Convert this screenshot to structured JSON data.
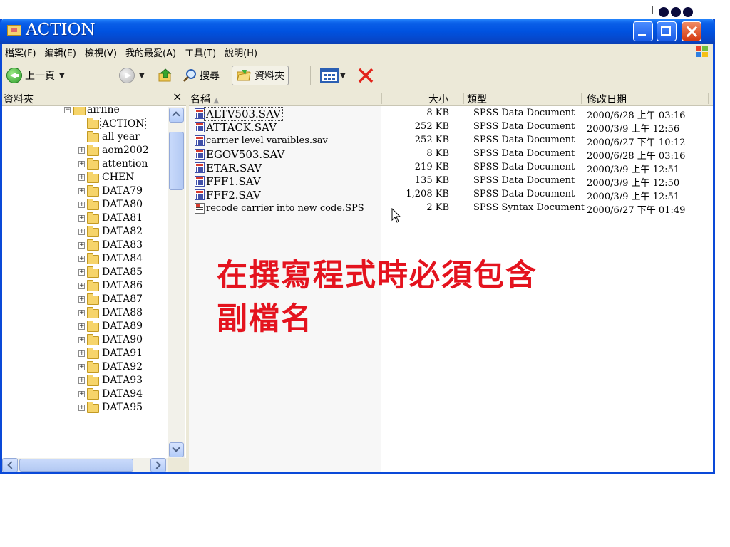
{
  "window": {
    "title": "ACTION"
  },
  "menubar": {
    "items": [
      "檔案(F)",
      "編輯(E)",
      "檢視(V)",
      "我的最愛(A)",
      "工具(T)",
      "說明(H)"
    ]
  },
  "toolbar": {
    "back_label": "上一頁",
    "search_label": "搜尋",
    "folders_label": "資料夾"
  },
  "folder_pane": {
    "title": "資料夾",
    "close_glyph": "×",
    "tree": [
      {
        "label": "airline",
        "level": 0,
        "expander": "−"
      },
      {
        "label": "ACTION",
        "level": 1,
        "selected": true
      },
      {
        "label": "all year",
        "level": 1
      },
      {
        "label": "aom2002",
        "level": 1,
        "expander": "+"
      },
      {
        "label": "attention",
        "level": 1,
        "expander": "+"
      },
      {
        "label": "CHEN",
        "level": 1,
        "expander": "+"
      },
      {
        "label": "DATA79",
        "level": 1,
        "expander": "+"
      },
      {
        "label": "DATA80",
        "level": 1,
        "expander": "+"
      },
      {
        "label": "DATA81",
        "level": 1,
        "expander": "+"
      },
      {
        "label": "DATA82",
        "level": 1,
        "expander": "+"
      },
      {
        "label": "DATA83",
        "level": 1,
        "expander": "+"
      },
      {
        "label": "DATA84",
        "level": 1,
        "expander": "+"
      },
      {
        "label": "DATA85",
        "level": 1,
        "expander": "+"
      },
      {
        "label": "DATA86",
        "level": 1,
        "expander": "+"
      },
      {
        "label": "DATA87",
        "level": 1,
        "expander": "+"
      },
      {
        "label": "DATA88",
        "level": 1,
        "expander": "+"
      },
      {
        "label": "DATA89",
        "level": 1,
        "expander": "+"
      },
      {
        "label": "DATA90",
        "level": 1,
        "expander": "+"
      },
      {
        "label": "DATA91",
        "level": 1,
        "expander": "+"
      },
      {
        "label": "DATA92",
        "level": 1,
        "expander": "+"
      },
      {
        "label": "DATA93",
        "level": 1,
        "expander": "+"
      },
      {
        "label": "DATA94",
        "level": 1,
        "expander": "+"
      },
      {
        "label": "DATA95",
        "level": 1,
        "expander": "+"
      }
    ]
  },
  "file_list": {
    "columns": {
      "name": "名稱",
      "size": "大小",
      "type": "類型",
      "modified": "修改日期"
    },
    "sort_indicator": "▲",
    "files": [
      {
        "name": "ALTV503.SAV",
        "size": "8 KB",
        "type": "SPSS Data Document",
        "modified": "2000/6/28 上午 03:16",
        "icon": "spss-data-icon",
        "selected": true
      },
      {
        "name": "ATTACK.SAV",
        "size": "252 KB",
        "type": "SPSS Data Document",
        "modified": "2000/3/9 上午 12:56",
        "icon": "spss-data-icon"
      },
      {
        "name": "carrier  level varaibles.sav",
        "size": "252 KB",
        "type": "SPSS Data Document",
        "modified": "2000/6/27 下午 10:12",
        "icon": "spss-data-icon"
      },
      {
        "name": "EGOV503.SAV",
        "size": "8 KB",
        "type": "SPSS Data Document",
        "modified": "2000/6/28 上午 03:16",
        "icon": "spss-data-icon"
      },
      {
        "name": "ETAR.SAV",
        "size": "219 KB",
        "type": "SPSS Data Document",
        "modified": "2000/3/9 上午 12:51",
        "icon": "spss-data-icon"
      },
      {
        "name": "FFF1.SAV",
        "size": "135 KB",
        "type": "SPSS Data Document",
        "modified": "2000/3/9 上午 12:50",
        "icon": "spss-data-icon"
      },
      {
        "name": "FFF2.SAV",
        "size": "1,208 KB",
        "type": "SPSS Data Document",
        "modified": "2000/3/9 上午 12:51",
        "icon": "spss-data-icon"
      },
      {
        "name": "recode carrier into new code.SPS",
        "size": "2 KB",
        "type": "SPSS Syntax Document",
        "modified": "2000/6/27 下午 01:49",
        "icon": "spss-syntax-icon"
      }
    ]
  },
  "annotation": {
    "line1": "在撰寫程式時必須包含",
    "line2": "副檔名",
    "color": "#e4131e"
  },
  "colors": {
    "titlebar": "#0052e0",
    "chrome": "#ece9d8",
    "close_button": "#d53a12"
  }
}
